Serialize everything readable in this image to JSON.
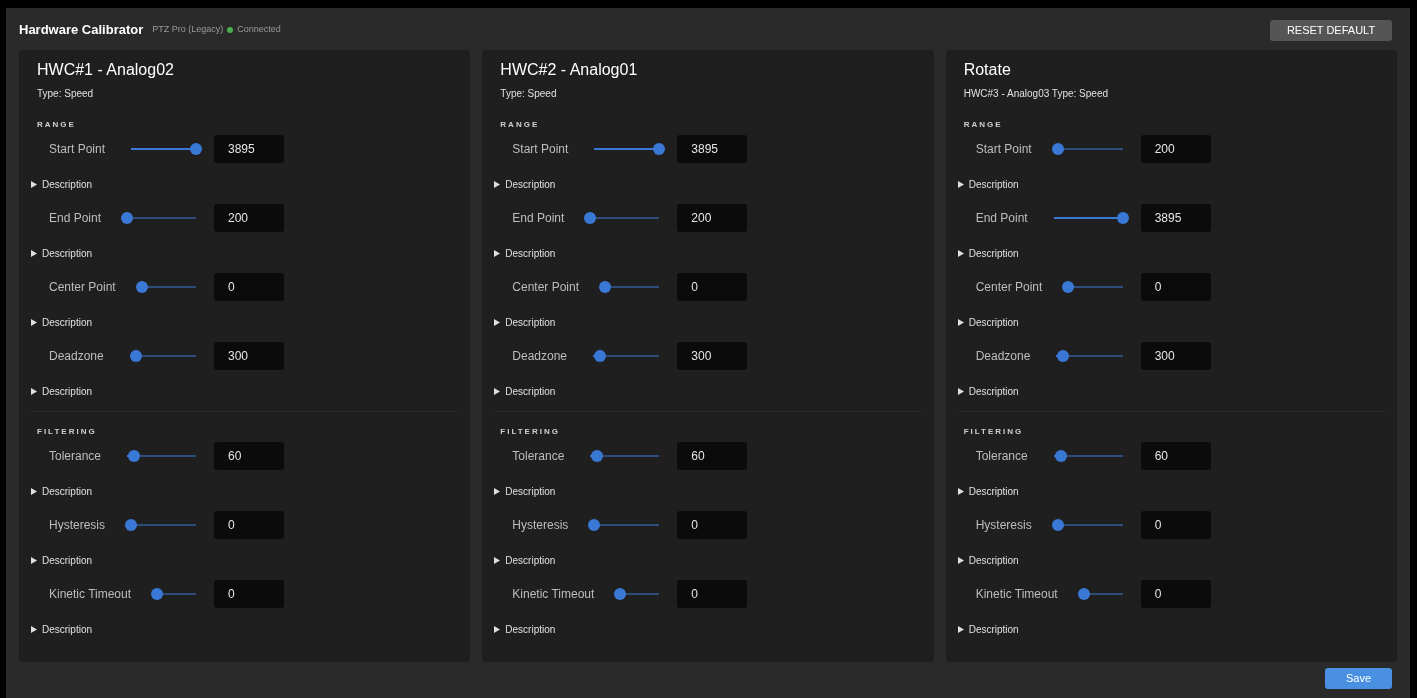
{
  "header": {
    "title": "Hardware Calibrator",
    "device": "PTZ Pro (Legacy)",
    "status": {
      "text": "Connected",
      "color": "#4caf50"
    }
  },
  "reset_button": "RESET DEFAULT",
  "panels": [
    {
      "title": "HWC#1 - Analog02",
      "subtitle": "Type: Speed",
      "sections": [
        {
          "heading": "RANGE",
          "params": [
            {
              "label": "Start Point",
              "value": "3895",
              "level": 1,
              "description": {
                "label": "Description",
                "expanded": false
              }
            },
            {
              "label": "End Point",
              "value": "200",
              "level": 0,
              "description": {
                "label": "Description",
                "expanded": false
              }
            },
            {
              "label": "Center Point",
              "value": "0",
              "level": 0,
              "description": {
                "label": "Description",
                "expanded": false
              }
            },
            {
              "label": "Deadzone",
              "value": "300",
              "level": 0.1,
              "description": {
                "label": "Description",
                "expanded": false
              }
            }
          ]
        },
        {
          "heading": "FILTERING",
          "params": [
            {
              "label": "Tolerance",
              "value": "60",
              "level": 0.1,
              "description": {
                "label": "Description",
                "expanded": false
              }
            },
            {
              "label": "Hysteresis",
              "value": "0",
              "level": 0,
              "description": {
                "label": "Description",
                "expanded": false
              }
            },
            {
              "label": "Kinetic Timeout",
              "value": "0",
              "level": 0,
              "description": {
                "label": "Description",
                "expanded": false
              }
            }
          ]
        }
      ]
    },
    {
      "title": "HWC#2 - Analog01",
      "subtitle": "Type: Speed",
      "sections": [
        {
          "heading": "RANGE",
          "params": [
            {
              "label": "Start Point",
              "value": "3895",
              "level": 1,
              "description": {
                "label": "Description",
                "expanded": false
              }
            },
            {
              "label": "End Point",
              "value": "200",
              "level": 0,
              "description": {
                "label": "Description",
                "expanded": false
              }
            },
            {
              "label": "Center Point",
              "value": "0",
              "level": 0,
              "description": {
                "label": "Description",
                "expanded": false
              }
            },
            {
              "label": "Deadzone",
              "value": "300",
              "level": 0.1,
              "description": {
                "label": "Description",
                "expanded": false
              }
            }
          ]
        },
        {
          "heading": "FILTERING",
          "params": [
            {
              "label": "Tolerance",
              "value": "60",
              "level": 0.1,
              "description": {
                "label": "Description",
                "expanded": false
              }
            },
            {
              "label": "Hysteresis",
              "value": "0",
              "level": 0,
              "description": {
                "label": "Description",
                "expanded": false
              }
            },
            {
              "label": "Kinetic Timeout",
              "value": "0",
              "level": 0,
              "description": {
                "label": "Description",
                "expanded": false
              }
            }
          ]
        }
      ]
    },
    {
      "title": "Rotate",
      "subtitle": "HWC#3 - Analog03 Type: Speed",
      "sections": [
        {
          "heading": "RANGE",
          "params": [
            {
              "label": "Start Point",
              "value": "200",
              "level": 0,
              "description": {
                "label": "Description",
                "expanded": false
              }
            },
            {
              "label": "End Point",
              "value": "3895",
              "level": 1,
              "description": {
                "label": "Description",
                "expanded": false
              }
            },
            {
              "label": "Center Point",
              "value": "0",
              "level": 0,
              "description": {
                "label": "Description",
                "expanded": false
              }
            },
            {
              "label": "Deadzone",
              "value": "300",
              "level": 0.1,
              "description": {
                "label": "Description",
                "expanded": false
              }
            }
          ]
        },
        {
          "heading": "FILTERING",
          "params": [
            {
              "label": "Tolerance",
              "value": "60",
              "level": 0.1,
              "description": {
                "label": "Description",
                "expanded": false
              }
            },
            {
              "label": "Hysteresis",
              "value": "0",
              "level": 0,
              "description": {
                "label": "Description",
                "expanded": false
              }
            },
            {
              "label": "Kinetic Timeout",
              "value": "0",
              "level": 0,
              "description": {
                "label": "Description",
                "expanded": false
              }
            }
          ]
        }
      ]
    }
  ],
  "save_button": "Save"
}
